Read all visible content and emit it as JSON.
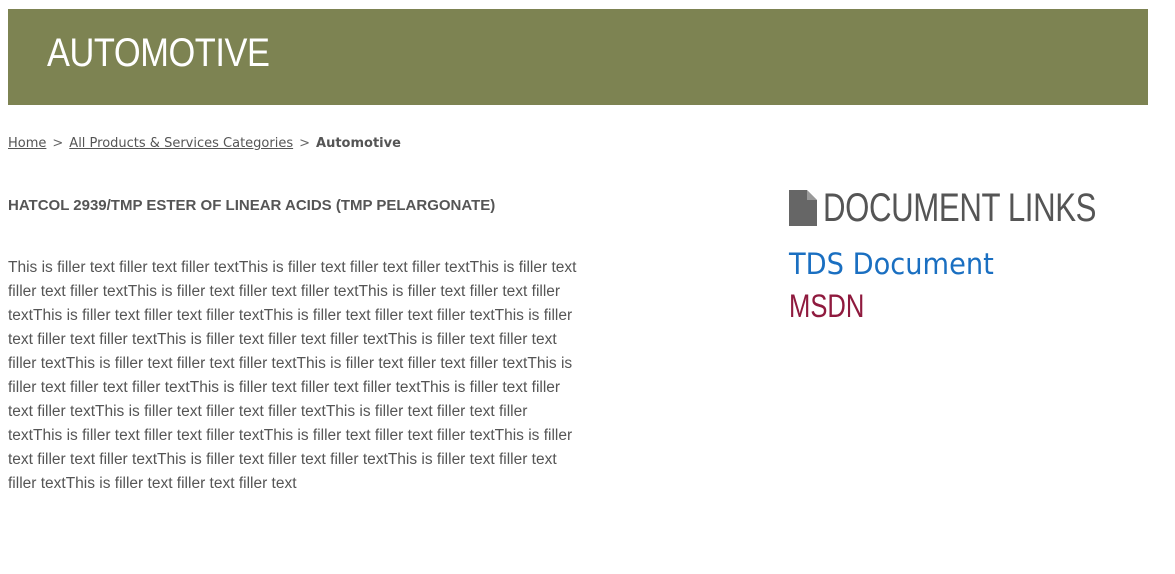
{
  "header": {
    "title": "AUTOMOTIVE",
    "background_color": "#7d8352"
  },
  "breadcrumb": {
    "home": "Home",
    "separator": ">",
    "category": "All Products & Services Categories",
    "current": "Automotive"
  },
  "product": {
    "title": "HATCOL 2939/TMP ESTER OF LINEAR ACIDS (TMP PELARGONATE)",
    "description": "This is filler text filler text filler textThis is filler text filler text filler textThis is filler text filler text filler textThis is filler text filler text filler textThis is filler text filler text filler textThis is filler text filler text filler textThis is filler text filler text filler textThis is filler text filler text filler textThis is filler text filler text filler textThis is filler text filler text filler textThis is filler text filler text filler textThis is filler text filler text filler textThis is filler text filler text filler textThis is filler text filler text filler textThis is filler text filler text filler textThis is filler text filler text filler textThis is filler text filler text filler textThis is filler text filler text filler textThis is filler text filler text filler textThis is filler text filler text filler textThis is filler text filler text filler textThis is filler text filler text filler textThis is filler text filler text filler text"
  },
  "document_links": {
    "heading": "DOCUMENT LINKS",
    "heading_icon": "document-icon",
    "tds_label": "TDS Document",
    "tds_color": "#1a6fc1",
    "msdn_label": "MSDN",
    "msdn_color": "#8f1a3e"
  }
}
